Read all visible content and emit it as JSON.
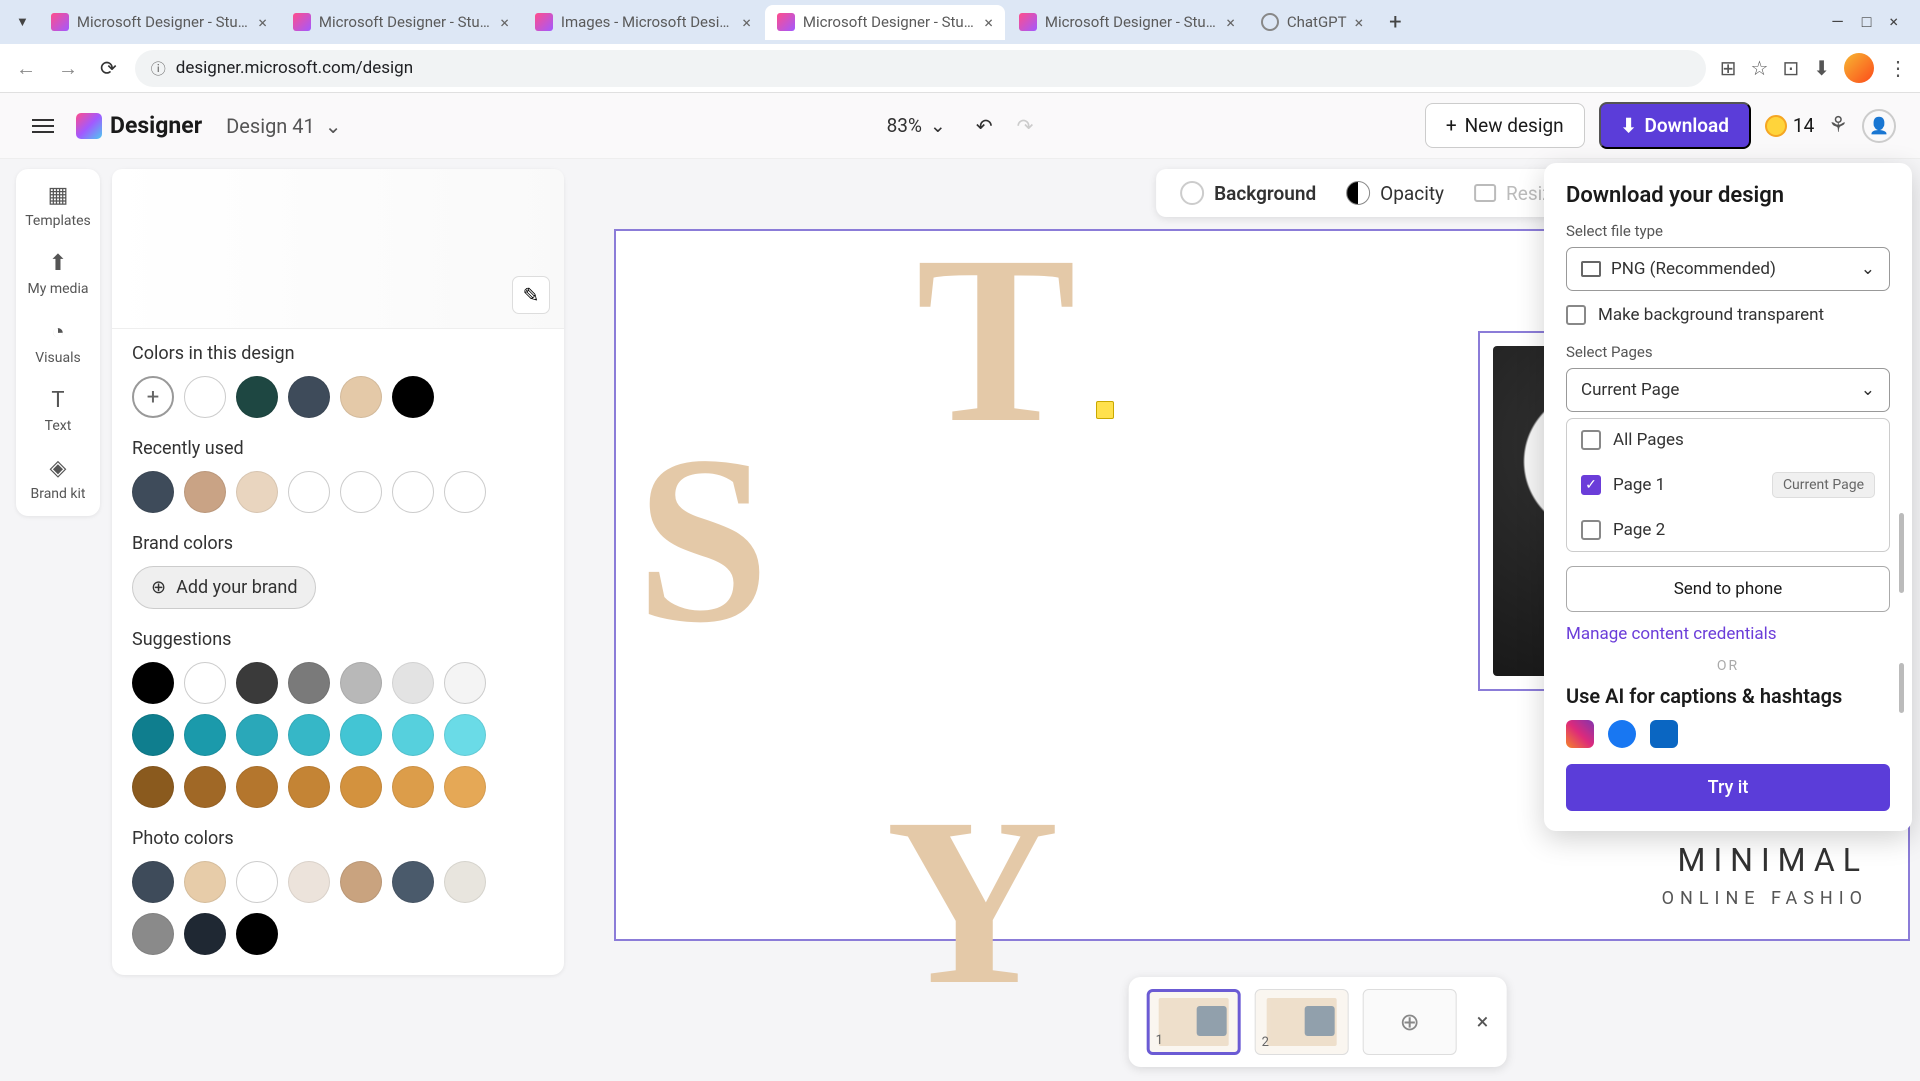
{
  "browser": {
    "tabs": [
      {
        "title": "Microsoft Designer - Stunning",
        "type": "designer"
      },
      {
        "title": "Microsoft Designer - Stunning",
        "type": "designer"
      },
      {
        "title": "Images - Microsoft Designer",
        "type": "designer"
      },
      {
        "title": "Microsoft Designer - Stunning",
        "type": "designer",
        "active": true
      },
      {
        "title": "Microsoft Designer - Stunning",
        "type": "designer"
      },
      {
        "title": "ChatGPT",
        "type": "chatgpt"
      }
    ],
    "url": "designer.microsoft.com/design"
  },
  "header": {
    "app_name": "Designer",
    "design_name": "Design 41",
    "zoom": "83%",
    "new_design_label": "New design",
    "download_label": "Download",
    "coins": "14"
  },
  "rail": {
    "items": [
      "Templates",
      "My media",
      "Visuals",
      "Text",
      "Brand kit"
    ]
  },
  "color_panel": {
    "section_colors_title": "Colors in this design",
    "colors_in_design": [
      "#ffffff",
      "#1e4742",
      "#3e4b5a",
      "#e4c9a8",
      "#000000"
    ],
    "section_recent_title": "Recently used",
    "recent": [
      "#3e4b5a",
      "#c9a385",
      "#e9d5bf",
      "#ffffff",
      "#ffffff",
      "#ffffff",
      "#ffffff"
    ],
    "section_brand_title": "Brand colors",
    "add_brand_label": "Add your brand",
    "section_suggestions_title": "Suggestions",
    "suggestions_row1": [
      "#000000",
      "#ffffff",
      "#3a3a3a",
      "#7a7a7a",
      "#b8b8b8",
      "#e3e3e3",
      "#f4f4f4"
    ],
    "suggestions_row2": [
      "#0f7e8e",
      "#1b9aab",
      "#2aa8b9",
      "#36b7c7",
      "#43c5d4",
      "#56d0dd",
      "#6adbe7"
    ],
    "suggestions_row3": [
      "#8a5a1e",
      "#a06826",
      "#b4762d",
      "#c48435",
      "#d3923e",
      "#dc9d4a",
      "#e5a856"
    ],
    "section_photo_title": "Photo colors",
    "photo_row1": [
      "#3e4b5a",
      "#e7cca9",
      "#ffffff",
      "#ece3db",
      "#c9a37f",
      "#4a5a6b",
      "#e8e5de"
    ],
    "photo_row2": [
      "#8a8a8a",
      "#1f2833",
      "#000000"
    ]
  },
  "canvas_toolbar": {
    "background": "Background",
    "opacity": "Opacity",
    "resize": "Resize"
  },
  "canvas": {
    "letter_t": "T",
    "letter_s": "S",
    "letter_y": "Y",
    "minimal": "MINIMAL",
    "online": "ONLINE FASHIO"
  },
  "pages": {
    "page1": "1",
    "page2": "2"
  },
  "download_popover": {
    "title": "Download your design",
    "file_type_label": "Select file type",
    "file_type_value": "PNG (Recommended)",
    "transparent_label": "Make background transparent",
    "select_pages_label": "Select Pages",
    "pages_dropdown_value": "Current Page",
    "all_pages": "All Pages",
    "page1": "Page 1",
    "page1_badge": "Current Page",
    "page2": "Page 2",
    "send_phone": "Send to phone",
    "manage_credentials": "Manage content credentials",
    "or": "OR",
    "ai_title": "Use AI for captions & hashtags",
    "try_it": "Try it"
  }
}
